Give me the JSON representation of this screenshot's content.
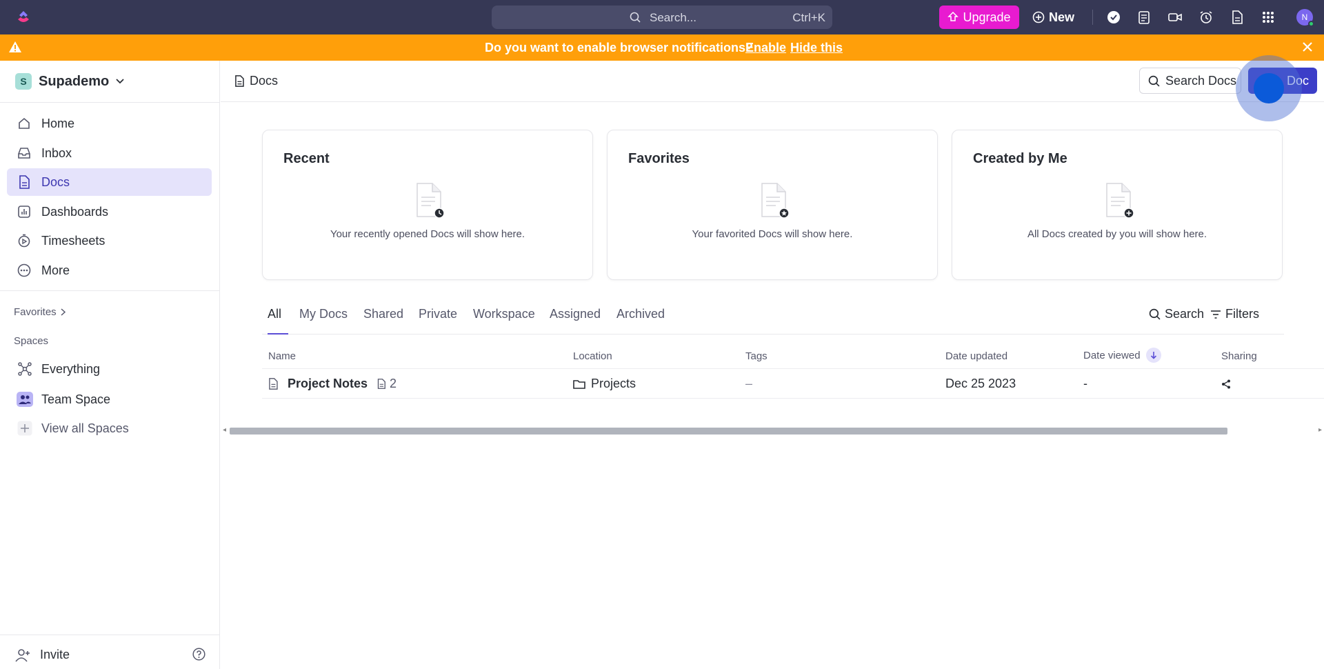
{
  "topbar": {
    "search_placeholder": "Search...",
    "search_shortcut": "Ctrl+K",
    "upgrade_label": "Upgrade",
    "new_label": "New",
    "avatar_initial": "N",
    "colors": {
      "bar": "#363855",
      "upgrade": "#e81bd0"
    }
  },
  "banner": {
    "message": "Do you want to enable browser notifications?",
    "enable_label": "Enable",
    "hide_label": "Hide this",
    "color": "#ff9f0a"
  },
  "sidebar": {
    "workspace_initial": "S",
    "workspace_name": "Supademo",
    "nav": [
      {
        "label": "Home",
        "icon": "home-icon"
      },
      {
        "label": "Inbox",
        "icon": "inbox-icon"
      },
      {
        "label": "Docs",
        "icon": "doc-icon",
        "active": true
      },
      {
        "label": "Dashboards",
        "icon": "dashboard-icon"
      },
      {
        "label": "Timesheets",
        "icon": "timesheet-icon"
      },
      {
        "label": "More",
        "icon": "more-icon"
      }
    ],
    "favorites_label": "Favorites",
    "spaces_label": "Spaces",
    "spaces": [
      {
        "label": "Everything",
        "icon": "everything-icon"
      },
      {
        "label": "Team Space",
        "icon": "team-space-icon"
      },
      {
        "label": "View all Spaces",
        "icon": "plus-icon"
      }
    ],
    "invite_label": "Invite",
    "active_color": "#e5e3fb"
  },
  "main": {
    "breadcrumb": "Docs",
    "search_docs_label": "Search Docs",
    "new_doc_label": "Doc",
    "cards": [
      {
        "title": "Recent",
        "text": "Your recently opened Docs will show here.",
        "badge": "clock"
      },
      {
        "title": "Favorites",
        "text": "Your favorited Docs will show here.",
        "badge": "star"
      },
      {
        "title": "Created by Me",
        "text": "All Docs created by you will show here.",
        "badge": "plus"
      }
    ],
    "tabs": [
      "All",
      "My Docs",
      "Shared",
      "Private",
      "Workspace",
      "Assigned",
      "Archived"
    ],
    "search_label": "Search",
    "filters_label": "Filters",
    "table": {
      "columns": [
        "Name",
        "Location",
        "Tags",
        "Date updated",
        "Date viewed",
        "Sharing"
      ],
      "rows": [
        {
          "name": "Project Notes",
          "pages": "2",
          "location": "Projects",
          "tags": "–",
          "date_updated": "Dec 25 2023",
          "date_viewed": "-"
        }
      ]
    }
  }
}
